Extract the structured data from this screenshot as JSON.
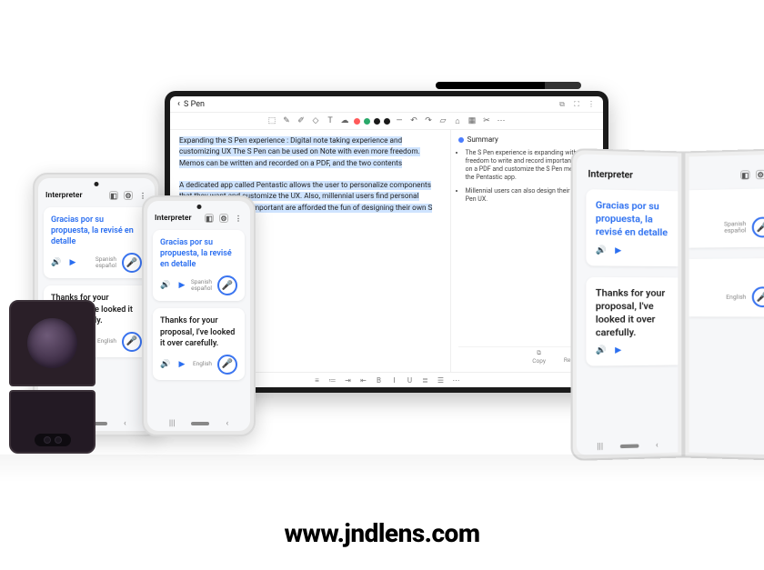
{
  "footer_url": "www.jndlens.com",
  "tablet": {
    "back_label": "S Pen",
    "note_paragraphs": [
      "Expanding the S Pen experience : Digital note taking experience and customizing UX The S Pen can be used on Note with even more freedom. Memos can be written and recorded on a PDF, and the two contents",
      "A dedicated app called Pentastic allows the user to personalize components that they want and customize the UX. Also, millennial users find personal expression to be very important are afforded the fun of designing their own S Pen UX."
    ],
    "summary_title": "Summary",
    "summary_bullets": [
      "The S Pen experience is expanding with more freedom to write and record important notes on a PDF and customize the S Pen menu with the Pentastic app.",
      "Millennial users can also design their own S Pen UX."
    ],
    "footer_actions": {
      "copy": "Copy",
      "replace": "Replace"
    },
    "colors": [
      "#ff5a5a",
      "#2aa96a",
      "#1a1a1a",
      "#1a1a1a"
    ]
  },
  "interpreter": {
    "title": "Interpreter",
    "top_text": "Gracias por su propuesta, la revisé en detalle",
    "top_lang_line1": "Spanish",
    "top_lang_line2": "español",
    "bottom_text": "Thanks for your proposal, I've looked it over carefully.",
    "bottom_lang_line1": "English",
    "bottom_lang_line2": ""
  },
  "phone1_bottom_text": "Thanks for your proposal, I've looked it over carefully."
}
